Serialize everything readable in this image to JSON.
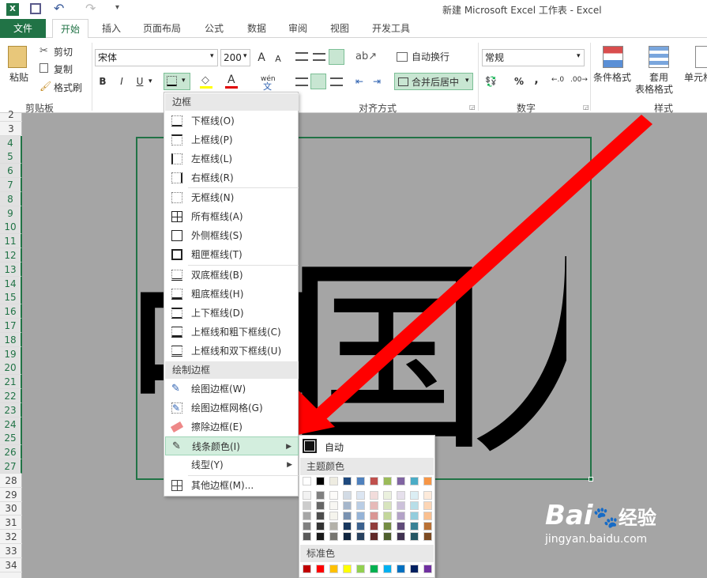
{
  "window": {
    "title": "新建 Microsoft Excel 工作表 - Excel"
  },
  "tabs": [
    "文件",
    "开始",
    "插入",
    "页面布局",
    "公式",
    "数据",
    "审阅",
    "视图",
    "开发工具"
  ],
  "ribbon": {
    "clipboard": {
      "paste": "粘贴",
      "cut": "剪切",
      "copy": "复制",
      "format_painter": "格式刷",
      "group": "剪贴板"
    },
    "font": {
      "name": "宋体",
      "size": "200",
      "bold": "B",
      "italic": "I",
      "underline": "U",
      "grow": "A",
      "shrink": "A",
      "phonetic": "wén"
    },
    "alignment": {
      "wrap": "自动换行",
      "merge": "合并后居中",
      "group": "对齐方式"
    },
    "number": {
      "format": "常规",
      "percent": "%",
      "comma": ",",
      "group": "数字"
    },
    "styles": {
      "conditional": "条件格式",
      "table1": "套用",
      "table2": "表格格式",
      "cell": "单元格",
      "group": "样式"
    }
  },
  "rows": [
    "2",
    "3",
    "4",
    "5",
    "6",
    "7",
    "8",
    "9",
    "10",
    "11",
    "12",
    "13",
    "14",
    "15",
    "16",
    "17",
    "18",
    "19",
    "20",
    "21",
    "22",
    "23",
    "24",
    "25",
    "26",
    "27",
    "28",
    "29",
    "30",
    "31",
    "32",
    "33",
    "34"
  ],
  "sheet_text": [
    "中",
    "国",
    "人"
  ],
  "border_menu": {
    "header1": "边框",
    "items1": [
      "下框线(O)",
      "上框线(P)",
      "左框线(L)",
      "右框线(R)"
    ],
    "items2": [
      "无框线(N)",
      "所有框线(A)",
      "外侧框线(S)",
      "粗匣框线(T)"
    ],
    "items3": [
      "双底框线(B)",
      "粗底框线(H)",
      "上下框线(D)",
      "上框线和粗下框线(C)",
      "上框线和双下框线(U)"
    ],
    "header2": "绘制边框",
    "items4": [
      "绘图边框(W)",
      "绘图边框网格(G)",
      "擦除边框(E)",
      "线条颜色(I)",
      "线型(Y)"
    ],
    "more": "其他边框(M)..."
  },
  "color_menu": {
    "auto": "自动",
    "theme": "主题颜色",
    "standard": "标准色",
    "theme_top": [
      "#ffffff",
      "#000000",
      "#eeece1",
      "#1f497d",
      "#4f81bd",
      "#c0504d",
      "#9bbb59",
      "#8064a2",
      "#4bacc6",
      "#f79646"
    ],
    "standard_colors": [
      "#c00000",
      "#ff0000",
      "#ffc000",
      "#ffff00",
      "#92d050",
      "#00b050",
      "#00b0f0",
      "#0070c0",
      "#002060",
      "#7030a0"
    ]
  },
  "watermark": {
    "brand": "Bai",
    "brand2": "经验",
    "url": "jingyan.baidu.com"
  }
}
